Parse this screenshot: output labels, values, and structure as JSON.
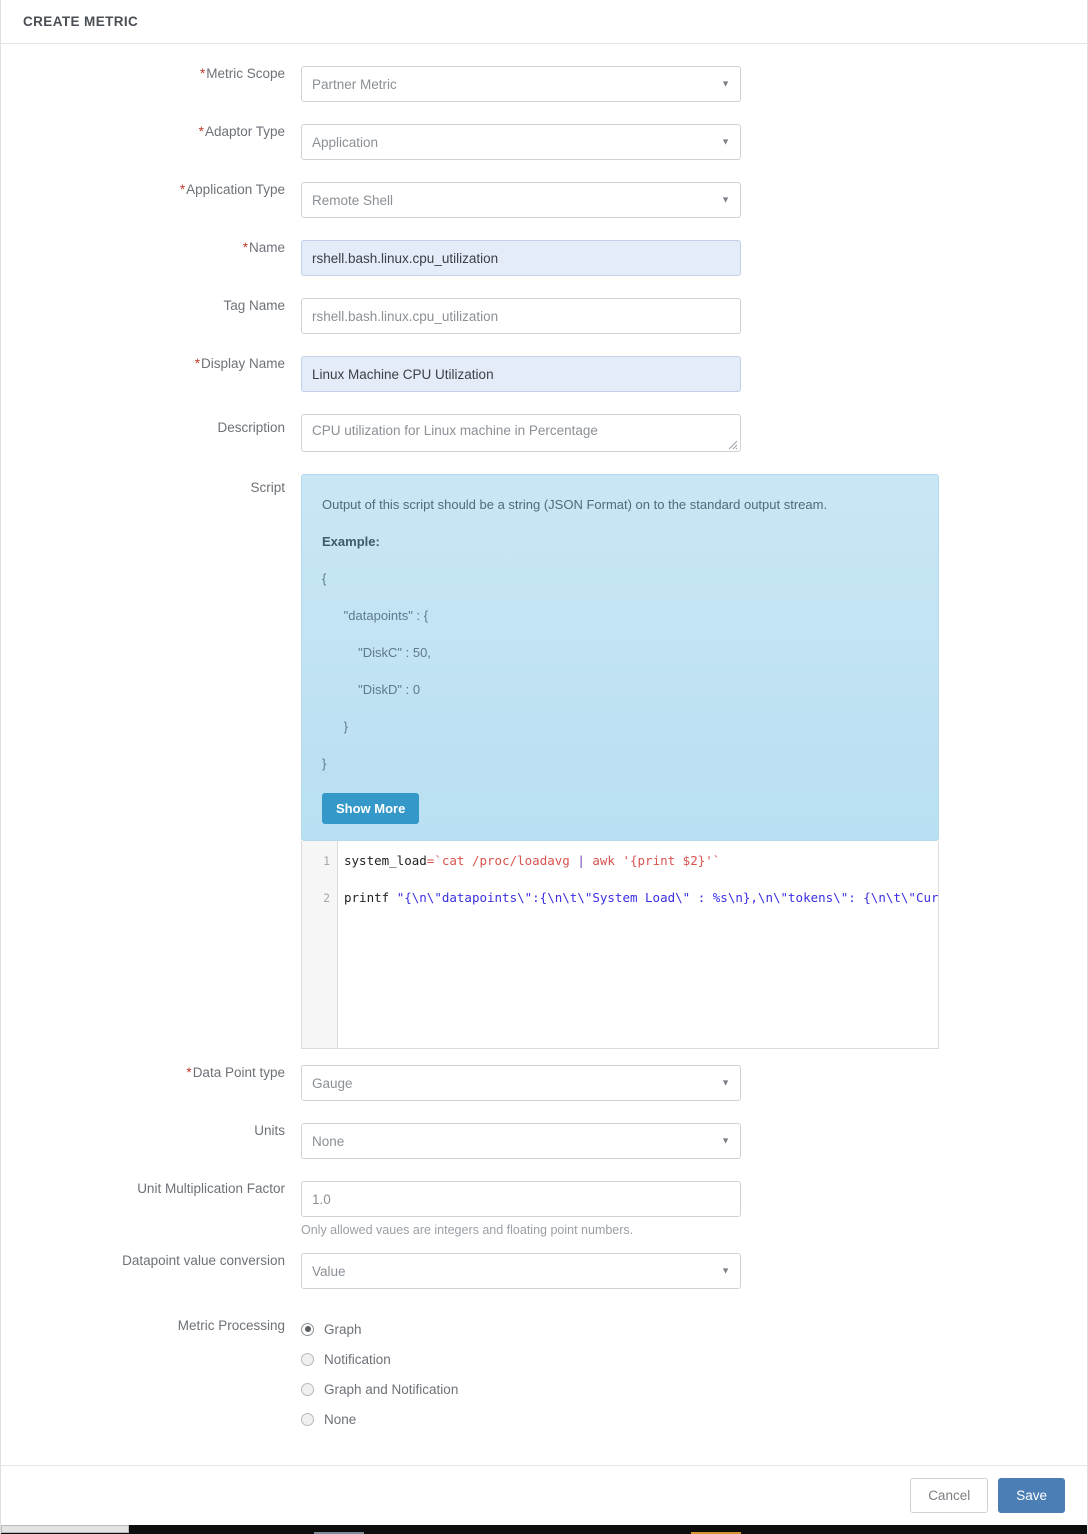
{
  "header": {
    "title": "CREATE METRIC"
  },
  "form": {
    "metric_scope": {
      "label": "Metric Scope",
      "required": true,
      "value": "Partner Metric",
      "type": "select"
    },
    "adaptor_type": {
      "label": "Adaptor Type",
      "required": true,
      "value": "Application",
      "type": "select"
    },
    "application_type": {
      "label": "Application Type",
      "required": true,
      "value": "Remote Shell",
      "type": "select"
    },
    "name": {
      "label": "Name",
      "required": true,
      "value": "rshell.bash.linux.cpu_utilization",
      "type": "text",
      "filled": true
    },
    "tag_name": {
      "label": "Tag Name",
      "required": false,
      "value": "rshell.bash.linux.cpu_utilization",
      "type": "text",
      "filled": false
    },
    "display_name": {
      "label": "Display Name",
      "required": true,
      "value": "Linux Machine CPU Utilization",
      "type": "text",
      "filled": true
    },
    "description": {
      "label": "Description",
      "required": false,
      "value": "CPU utilization for Linux machine in Percentage",
      "type": "textarea"
    },
    "script": {
      "label": "Script"
    },
    "data_point_type": {
      "label": "Data Point type",
      "required": true,
      "value": "Gauge",
      "type": "select"
    },
    "units": {
      "label": "Units",
      "required": false,
      "value": "None",
      "type": "select"
    },
    "unit_multiplication_factor": {
      "label": "Unit Multiplication Factor",
      "required": false,
      "value": "1.0",
      "type": "text",
      "helper": "Only allowed vaues are integers and floating point numbers."
    },
    "datapoint_value_conversion": {
      "label": "Datapoint value conversion",
      "required": false,
      "value": "Value",
      "type": "select"
    },
    "metric_processing": {
      "label": "Metric Processing",
      "options": [
        {
          "label": "Graph",
          "checked": true
        },
        {
          "label": "Notification",
          "checked": false
        },
        {
          "label": "Graph and Notification",
          "checked": false
        },
        {
          "label": "None",
          "checked": false
        }
      ]
    }
  },
  "script_panel": {
    "intro": "Output of this script should be a string (JSON Format) on to the standard output stream.",
    "example_label": "Example:",
    "example_lines": [
      "{",
      "      \"datapoints\" : {",
      "          \"DiskC\" : 50,",
      "          \"DiskD\" : 0",
      "      }",
      "}"
    ],
    "show_more_label": "Show More"
  },
  "editor": {
    "line_numbers": [
      "1",
      "2"
    ],
    "lines": [
      "system_load=`cat /proc/loadavg | awk '{print $2}'`",
      "printf \"{\\n\\\"datapoints\\\":{\\n\\t\\\"System Load\\\" : %s\\n},\\n\\\"tokens\\\": {\\n\\t\\\"Curren"
    ]
  },
  "footer": {
    "cancel_label": "Cancel",
    "save_label": "Save"
  },
  "colors": {
    "required_marker": "#c0392b",
    "save_button": "#4a7eb5",
    "show_more_button": "#3498c8",
    "info_panel": "#c2e3f3",
    "filled_input": "#e5ecf9"
  }
}
